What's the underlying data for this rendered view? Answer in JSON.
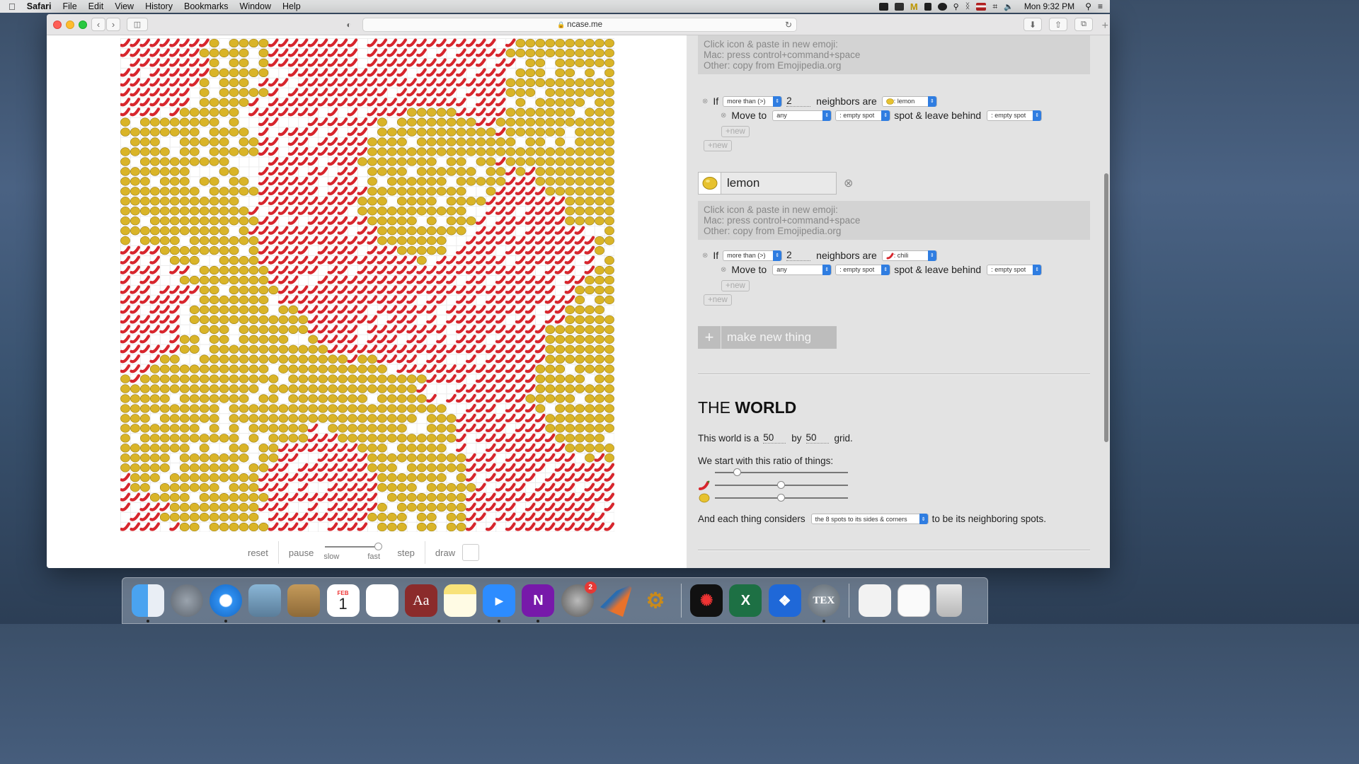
{
  "menubar": {
    "app": "Safari",
    "items": [
      "File",
      "Edit",
      "View",
      "History",
      "Bookmarks",
      "Window",
      "Help"
    ],
    "clock": "Mon 9:32 PM"
  },
  "browser": {
    "url": "ncase.me"
  },
  "simulation": {
    "grid_cols": 50,
    "grid_rows": 50,
    "cell_types": [
      "chili",
      "lemon",
      "empty"
    ],
    "colors": {
      "chili": "#d7262d",
      "lemon": "#d9b428",
      "grid_line": "#ececec"
    },
    "controls": {
      "reset": "reset",
      "pause": "pause",
      "slow": "slow",
      "fast": "fast",
      "step": "step",
      "draw": "draw"
    }
  },
  "editor": {
    "hint_lines": [
      "Click icon & paste in new emoji:",
      "Mac: press control+command+space",
      "Other: copy from Emojipedia.org"
    ],
    "rule1": {
      "if": "If",
      "comparator": "more than (>)",
      "count": "2",
      "neighbors_are": "neighbors are",
      "neighbor_thing": ": lemon",
      "move_to": "Move to",
      "direction": "any",
      "target": ": empty spot",
      "leave_text": "spot & leave behind",
      "leave_thing": ": empty spot"
    },
    "new_label": "+new",
    "thing_name": "lemon",
    "rule2": {
      "if": "If",
      "comparator": "more than (>)",
      "count": "2",
      "neighbors_are": "neighbors are",
      "neighbor_thing": ": chili",
      "move_to": "Move to",
      "direction": "any",
      "target": ": empty spot",
      "leave_text": "spot & leave behind",
      "leave_thing": ": empty spot"
    },
    "make_new_thing": "make new thing"
  },
  "world": {
    "title_prefix": "THE",
    "title_bold": "WORLD",
    "grid_text_pre": "This world is a",
    "width": "50",
    "grid_text_mid": "by",
    "height": "50",
    "grid_text_post": "grid.",
    "ratio_text": "We start with this ratio of things:",
    "ratio_levels": [
      0.15,
      0.5,
      0.5
    ],
    "neighbors_pre": "And each thing considers",
    "neighbors_option": "the 8 spots to its sides & corners",
    "neighbors_post": "to be its neighboring spots."
  },
  "dock": {
    "apps": [
      "finder",
      "launchpad",
      "safari",
      "mail-eagle",
      "contacts",
      "calendar",
      "reminders",
      "dictionary",
      "notes",
      "zoom",
      "onenote",
      "system-preferences",
      "matlab",
      "microscope",
      "acrobat",
      "excel",
      "dropbox",
      "tex",
      "documents",
      "preview",
      "trash"
    ],
    "calendar_month": "FEB",
    "calendar_day": "1",
    "sysprefs_badge": "2",
    "dictionary_label": "Aa",
    "onenote_label": "N",
    "excel_label": "X",
    "tex_label": "TEX"
  }
}
